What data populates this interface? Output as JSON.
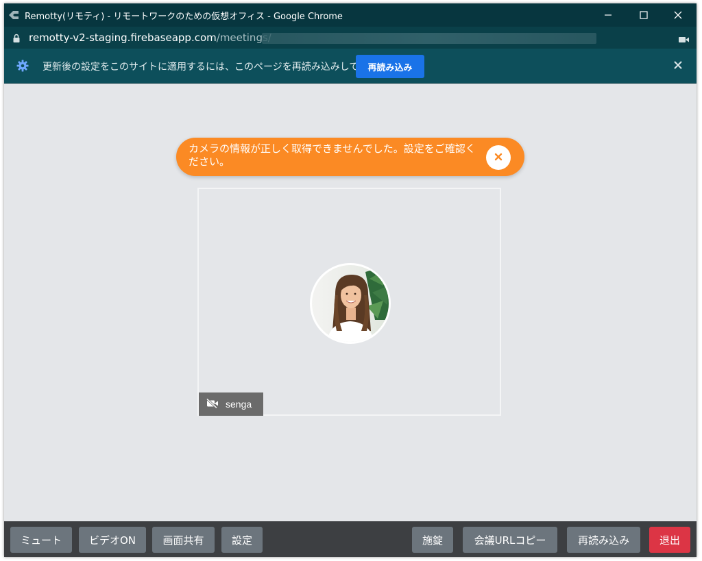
{
  "window": {
    "title": "Remotty(リモティ) - リモートワークのための仮想オフィス - Google Chrome",
    "url_host": "remotty-v2-staging.firebaseapp.com",
    "url_path": "/meetings/"
  },
  "infobar": {
    "message": "更新後の設定をこのサイトに適用するには、このページを再読み込みしてください",
    "reload_label": "再読み込み"
  },
  "alert": {
    "message": "カメラの情報が正しく取得できませんでした。設定をご確認ください。",
    "close_glyph": "×"
  },
  "participant": {
    "name": "senga",
    "video_off": true
  },
  "toolbar": {
    "mute_label": "ミュート",
    "video_label": "ビデオON",
    "screen_share_label": "画面共有",
    "settings_label": "設定",
    "lock_label": "施錠",
    "copy_url_label": "会議URLコピー",
    "reload_label": "再読み込み",
    "exit_label": "退出"
  },
  "colors": {
    "titlebar": "#07363f",
    "infobar": "#0d4f5b",
    "alert": "#fb8a24",
    "primary_button": "#1a73e8",
    "toolbar_button": "#6c757d",
    "exit_button": "#dc3545"
  }
}
